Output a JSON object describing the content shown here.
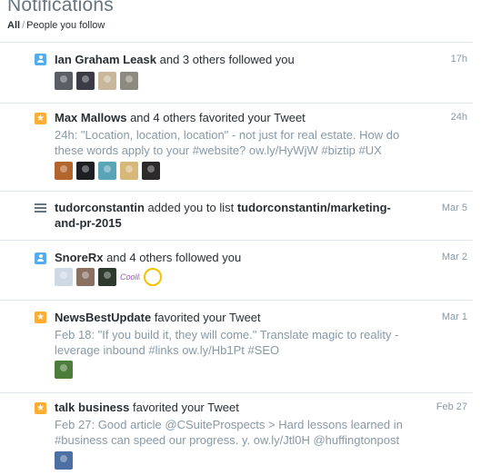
{
  "header": {
    "title": "Notifications",
    "filter_all": "All",
    "filter_sep": "/",
    "filter_following": "People you follow"
  },
  "notifications": [
    {
      "actor": "Ian Graham Leask",
      "action": " and 3 others followed you",
      "time": "17h",
      "icon": "person-icon",
      "avatars": [
        "#5a5f66",
        "#3b3b45",
        "#c9b79c",
        "#8d8a80"
      ]
    },
    {
      "actor": "Max Mallows",
      "action": " and 4 others favorited your Tweet",
      "time": "24h",
      "icon": "star-icon",
      "tweet": "24h: \"Location, location, location\" - not just for real estate. How do these words apply to your #website? ow.ly/HyWjW #biztip #UX",
      "avatars": [
        "#b4652e",
        "#1d1f23",
        "#5aa4b8",
        "#d7b77a",
        "#2c2a2a"
      ]
    },
    {
      "actor": "tudorconstantin",
      "action": " added you to list ",
      "target": "tudorconstantin/marketing-and-pr-2015",
      "target_line2": "and-pr-2015",
      "target_line1": "tudorconstantin/marketing-",
      "time": "Mar 5",
      "icon": "list-icon"
    },
    {
      "actor": "SnoreRx",
      "action": " and 4 others followed you",
      "time": "Mar 2",
      "icon": "person-icon",
      "avatars": [
        "#cfd9e3",
        "#8a7060",
        "#2f3a2f",
        "CoolIt",
        "#f2c200"
      ]
    },
    {
      "actor": "NewsBestUpdate",
      "action": " favorited your Tweet",
      "time": "Mar 1",
      "icon": "star-icon",
      "tweet": "Feb 18: \"If you build it, they will come.\" Translate magic to reality - leverage inbound #links ow.ly/Hb1Pt #SEO",
      "avatars": [
        "#4c7d3a"
      ]
    },
    {
      "actor": "talk business",
      "action": " favorited your Tweet",
      "time": "Feb 27",
      "icon": "star-icon",
      "tweet": "Feb 27: Good article @CSuiteProspects > Hard lessons learned in #business can speed our progress. y. ow.ly/Jtl0H @huffingtonpost",
      "avatars": [
        "#4d6fa3"
      ]
    }
  ],
  "colors": {
    "follow": "#55acee",
    "favorite": "#ffac33",
    "muted": "#8899a6"
  }
}
